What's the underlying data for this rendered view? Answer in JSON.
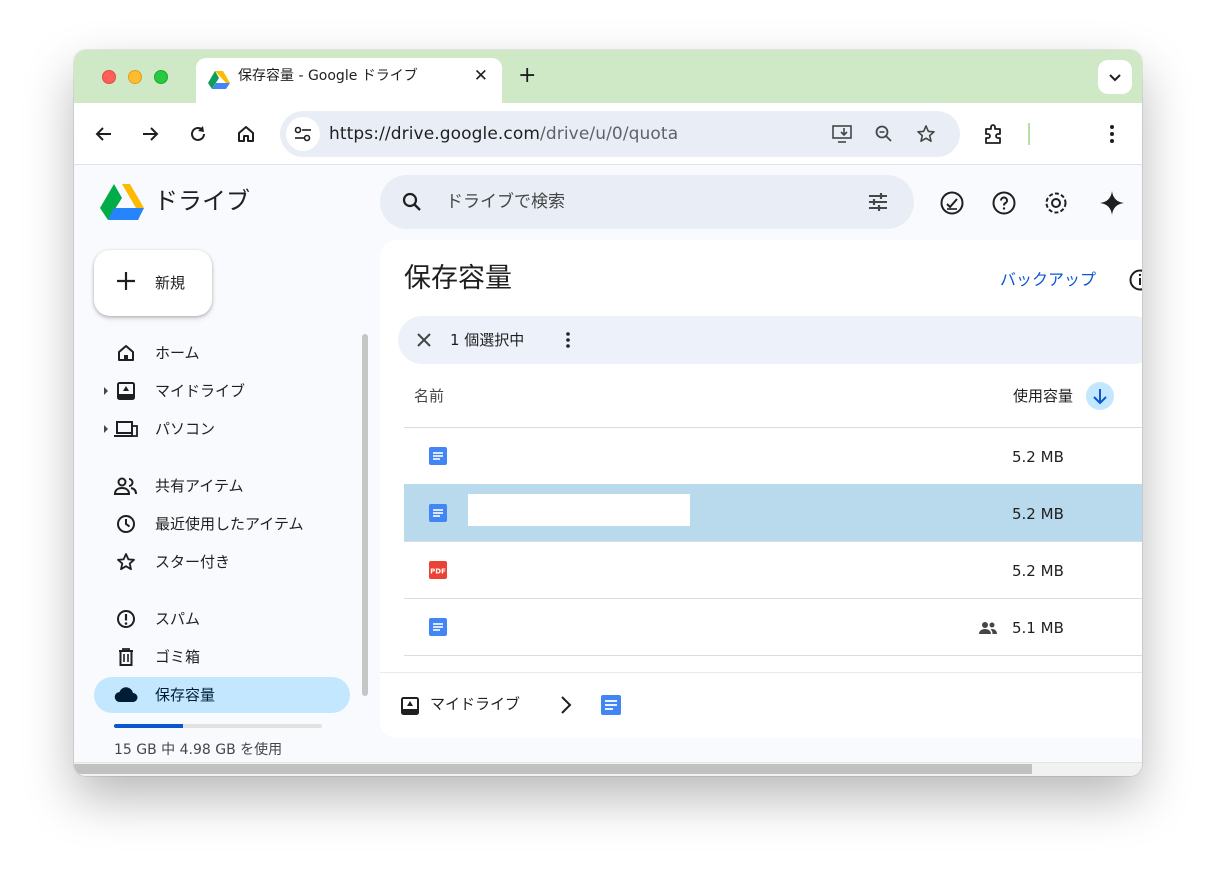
{
  "browser": {
    "tab_title": "保存容量 - Google ドライブ",
    "tab_close": "✕",
    "new_tab": "+",
    "url_host": "https://drive.google.com",
    "url_path": "/drive/u/0/quota"
  },
  "app": {
    "name": "ドライブ",
    "search_placeholder": "ドライブで検索"
  },
  "nav": {
    "new_label": "新規",
    "items": [
      {
        "label": "ホーム",
        "icon": "home-icon"
      },
      {
        "label": "マイドライブ",
        "icon": "my-drive-icon"
      },
      {
        "label": "パソコン",
        "icon": "computers-icon"
      },
      {
        "label": "共有アイテム",
        "icon": "shared-people-icon"
      },
      {
        "label": "最近使用したアイテム",
        "icon": "clock-icon"
      },
      {
        "label": "スター付き",
        "icon": "star-icon"
      },
      {
        "label": "スパム",
        "icon": "spam-icon"
      },
      {
        "label": "ゴミ箱",
        "icon": "trash-icon"
      },
      {
        "label": "保存容量",
        "icon": "cloud-icon",
        "active": true
      }
    ],
    "storage": {
      "text": "15 GB 中 4.98 GB を使用",
      "used_fraction": 0.332
    }
  },
  "main": {
    "title": "保存容量",
    "backup_link": "バックアップ",
    "selection_text": "1 個選択中",
    "columns": {
      "name": "名前",
      "size": "使用容量"
    },
    "rows": [
      {
        "type": "docs",
        "size": "5.2 MB",
        "selected": false,
        "shared": false
      },
      {
        "type": "docs",
        "size": "5.2 MB",
        "selected": true,
        "shared": false
      },
      {
        "type": "pdf",
        "size": "5.2 MB",
        "selected": false,
        "shared": false,
        "badge": "PDF"
      },
      {
        "type": "docs",
        "size": "5.1 MB",
        "selected": false,
        "shared": true
      }
    ],
    "breadcrumb": {
      "label": "マイドライブ"
    }
  },
  "colors": {
    "accent": "#0b57d0",
    "active_nav": "#c2e7ff",
    "selected_row": "#b9d9ec",
    "tabstrip": "#cfe8c6"
  }
}
